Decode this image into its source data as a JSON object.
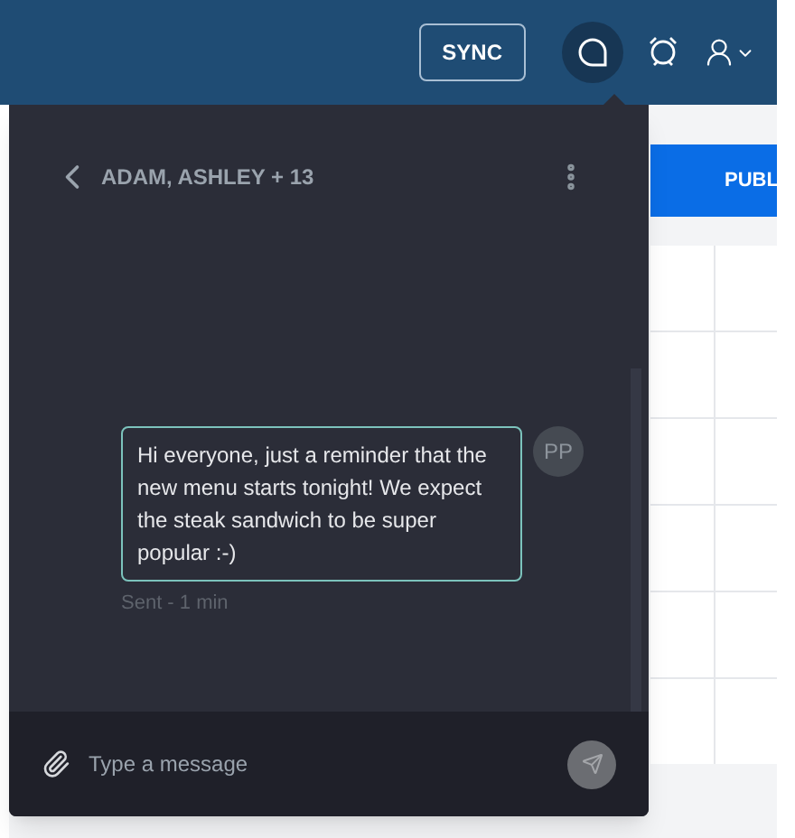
{
  "topbar": {
    "sync_button": "SYNC",
    "chat_selected": true
  },
  "background": {
    "publish_button": "PUBL"
  },
  "chat": {
    "title": "ADAM, ASHLEY + 13",
    "messages": [
      {
        "text": "Hi everyone, just a reminder that the new menu starts tonight! We expect the steak sandwich to be super popular :-)",
        "avatar": "PP",
        "status": "Sent - 1 min"
      }
    ],
    "composer": {
      "placeholder": "Type a message"
    }
  }
}
